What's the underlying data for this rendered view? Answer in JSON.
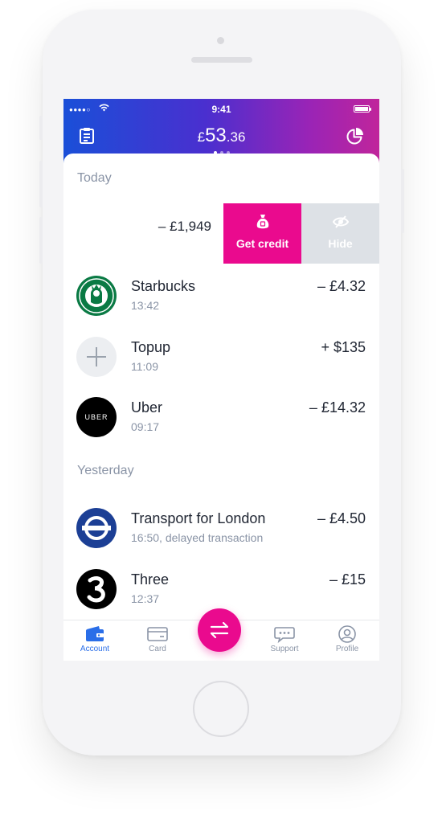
{
  "status_bar": {
    "time": "9:41",
    "signal": "●●●●○"
  },
  "header": {
    "balance_currency": "£",
    "balance_integer": "53",
    "balance_decimal": ".36"
  },
  "sections": {
    "today": "Today",
    "yesterday": "Yesterday"
  },
  "swiped_transaction": {
    "amount": "– £1,949",
    "get_credit_label": "Get credit",
    "hide_label": "Hide"
  },
  "transactions": [
    {
      "merchant": "Starbucks",
      "time": "13:42",
      "amount": "– £4.32"
    },
    {
      "merchant": "Topup",
      "time": "11:09",
      "amount": "+ $135"
    },
    {
      "merchant": "Uber",
      "time": "09:17",
      "amount": "– £14.32",
      "logo_text": "UBER"
    },
    {
      "merchant": "Transport for London",
      "time": "16:50, delayed transaction",
      "amount": "– £4.50"
    },
    {
      "merchant": "Three",
      "time": "12:37",
      "amount": "– £15"
    }
  ],
  "tabs": {
    "account": "Account",
    "card": "Card",
    "support": "Support",
    "profile": "Profile"
  },
  "colors": {
    "accent_pink": "#ea0a8e",
    "accent_blue": "#2a6ee8",
    "starbucks_green": "#0a7a44",
    "tfl_blue": "#1c3f95"
  }
}
